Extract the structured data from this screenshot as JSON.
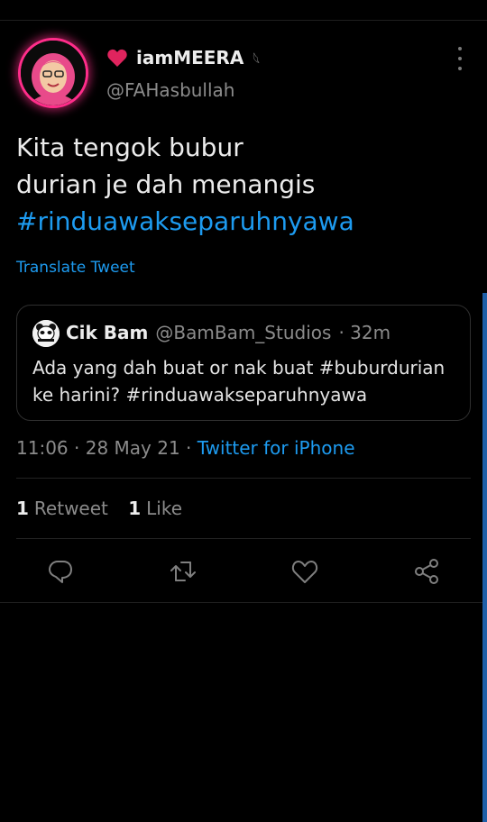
{
  "tweet": {
    "display_name": "iamMEERA",
    "name_glyph": "𓆩",
    "handle": "@FAHasbullah",
    "text_lines": [
      "Kita tengok bubur",
      "durian je dah menangis"
    ],
    "hashtag": "#rinduawakseparuhnyawa",
    "translate_label": "Translate Tweet"
  },
  "quote": {
    "name": "Cik Bam",
    "handle": "@BamBam_Studios",
    "time": "· 32m",
    "text_lines": [
      "Ada yang dah buat or nak buat #buburdurian",
      "ke harini? #rinduawakseparuhnyawa"
    ]
  },
  "meta": {
    "time": "11:06",
    "date": "· 28 May 21 ·",
    "source": "Twitter for iPhone"
  },
  "stats": {
    "retweets_count": "1",
    "retweets_label": "Retweet",
    "likes_count": "1",
    "likes_label": "Like"
  },
  "icons": {
    "reply": "reply-icon",
    "retweet": "retweet-icon",
    "like": "heart-icon",
    "share": "share-icon",
    "more": "more-vertical-icon"
  },
  "colors": {
    "background": "#000000",
    "link": "#1d9bf0",
    "avatar_ring": "#ff2d8a",
    "heart": "#e0245e"
  }
}
